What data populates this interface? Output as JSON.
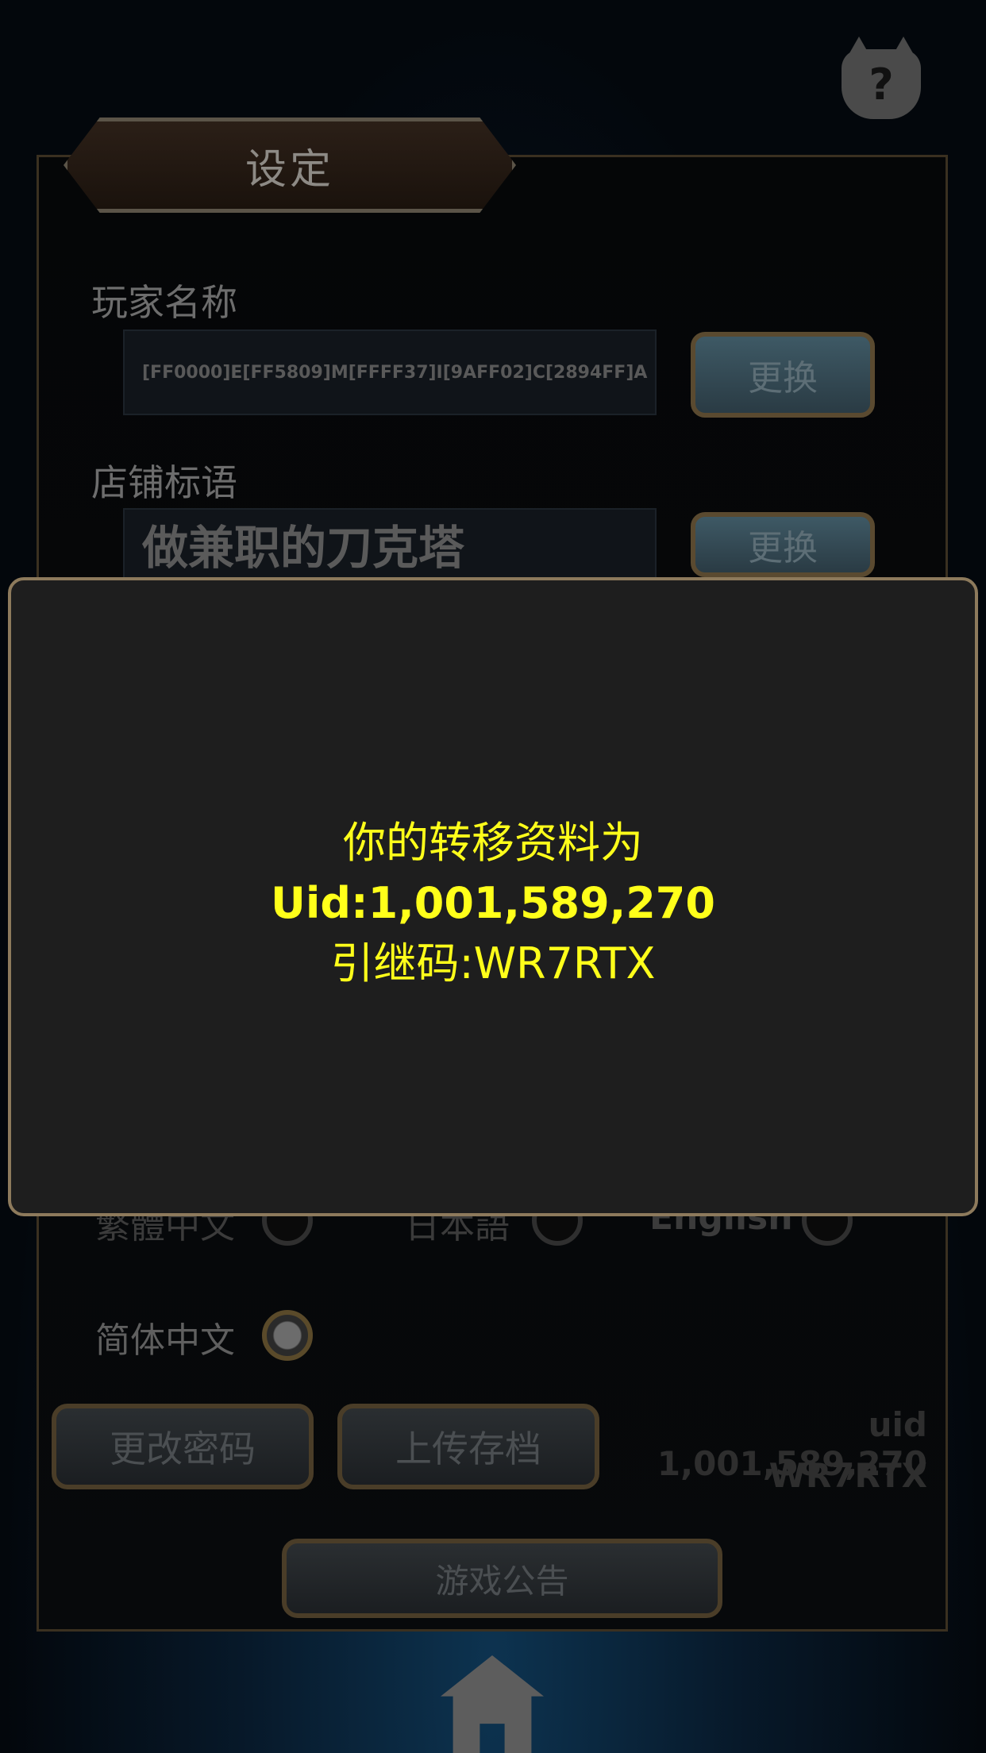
{
  "header": {
    "title": "设定"
  },
  "player_name": {
    "label": "玩家名称",
    "value": "[FF0000]E[FF5809]M[FFFF37]I[9AFF02]C[2894FF]A",
    "change_label": "更换"
  },
  "shop_slogan": {
    "label": "店铺标语",
    "value": "做兼职的刀克塔",
    "change_label": "更换"
  },
  "languages": {
    "traditional": "繁體中文",
    "japanese": "日本語",
    "english": "English",
    "simplified": "简体中文",
    "selected": "简体中文"
  },
  "actions": {
    "change_password": "更改密码",
    "upload_save": "上传存档",
    "announcement": "游戏公告"
  },
  "account": {
    "uid_text": "uid 1,001,589,270",
    "code_text": "WR7RTX"
  },
  "modal": {
    "line1": "你的转移资料为",
    "line2": "Uid:1,001,589,270",
    "line3": "引继码:WR7RTX"
  },
  "icons": {
    "help": "help-cat-icon",
    "home": "home-icon"
  },
  "colors": {
    "modal_text": "#ffff1a",
    "modal_bg": "#1e1e1e",
    "modal_border": "#8d7a5c"
  }
}
